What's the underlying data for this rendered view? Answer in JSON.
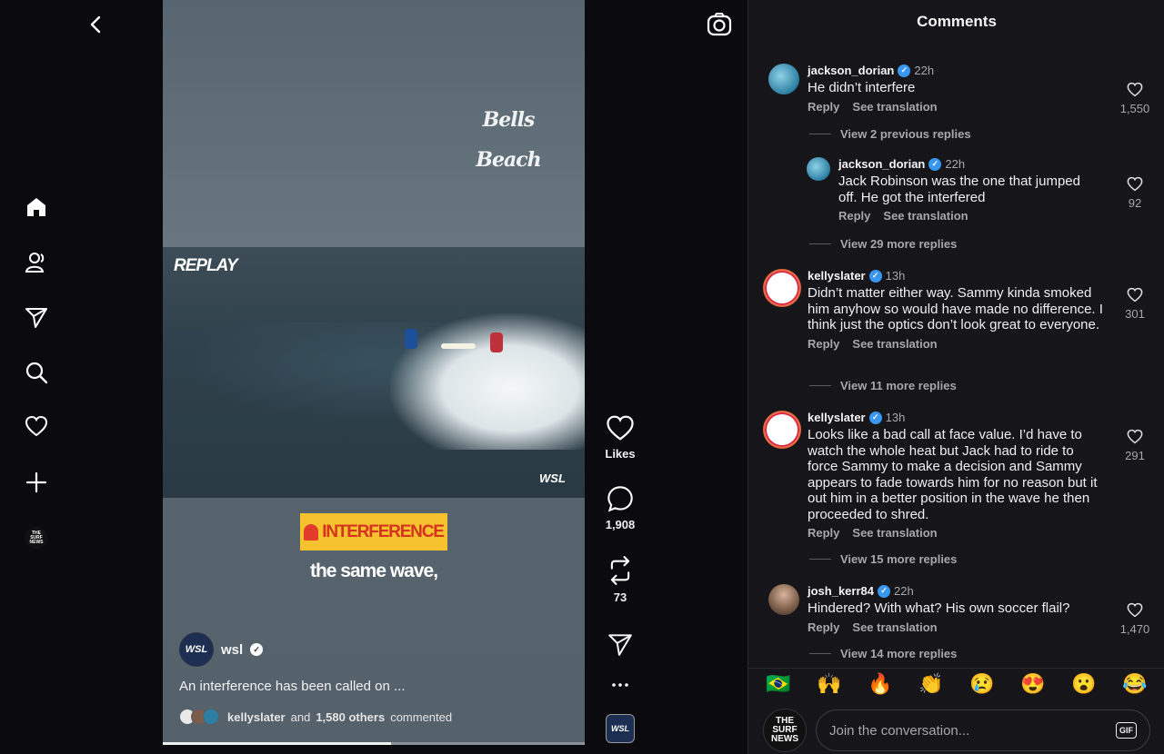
{
  "nav": {
    "items": [
      "home-icon",
      "profile-icon",
      "send-icon",
      "search-icon",
      "heart-icon",
      "plus-icon"
    ],
    "account_logo_lines": [
      "THE",
      "SURF",
      "NEWS"
    ]
  },
  "video": {
    "overlay_brand": "Bells Beach",
    "replay_label": "REPLAY",
    "watermark": "WSL",
    "interference_banner": "INTERFERENCE",
    "subtitle": "the same wave,",
    "author": "wsl",
    "author_avatar_label": "WSL",
    "caption": "An interference has been called on ...",
    "commenters": {
      "lead": "kellyslater",
      "and": "and",
      "others": "1,580 others",
      "suffix": "commented"
    },
    "progress": 0.54
  },
  "actions": {
    "likes_label": "Likes",
    "comments_count": "1,908",
    "reposts_count": "73",
    "more_icon": "more-icon",
    "mini_label": "WSL"
  },
  "comments_panel": {
    "title": "Comments",
    "comments": [
      {
        "user": "jackson_dorian",
        "time": "22h",
        "text": "He didn’t interfere",
        "reply": "Reply",
        "translate": "See translation",
        "likes": "1,550",
        "view": "View 2 previous replies"
      },
      {
        "user": "jackson_dorian",
        "time": "22h",
        "text": "Jack Robinson was the one that jumped off. He got the interfered",
        "reply": "Reply",
        "translate": "See translation",
        "likes": "92",
        "view": "View 29 more replies"
      },
      {
        "user": "kellyslater",
        "time": "13h",
        "text": "Didn’t matter either way. Sammy kinda smoked him anyhow so would have made no difference. I think just the optics don’t look great to everyone.",
        "reply": "Reply",
        "translate": "See translation",
        "likes": "301",
        "view": "View 11 more replies"
      },
      {
        "user": "kellyslater",
        "time": "13h",
        "text": "Looks like a bad call at face value. I’d have to watch the whole heat but Jack had to ride to force Sammy to make a decision and Sammy appears to fade towards him for no reason but it out him in a better position in the wave he then proceeded to shred.",
        "reply": "Reply",
        "translate": "See translation",
        "likes": "291",
        "view": "View 15 more replies"
      },
      {
        "user": "josh_kerr84",
        "time": "22h",
        "text": "Hindered? With what? His own soccer flail?",
        "reply": "Reply",
        "translate": "See translation",
        "likes": "1,470",
        "view": "View 14 more replies"
      }
    ],
    "reactions": [
      "🇧🇷",
      "🙌",
      "🔥",
      "👏",
      "😢",
      "😍",
      "😮",
      "😂"
    ],
    "compose_placeholder": "Join the conversation...",
    "gif_label": "GIF",
    "me_logo_lines": [
      "THE",
      "SURF",
      "NEWS"
    ]
  }
}
